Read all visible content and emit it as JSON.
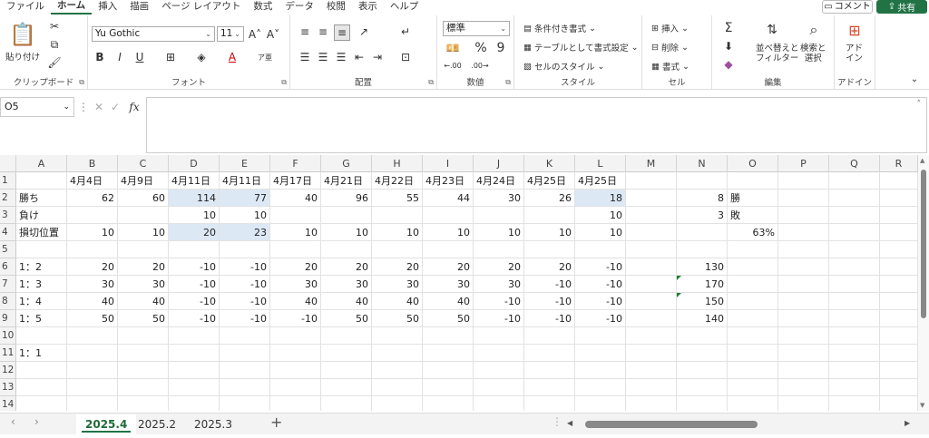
{
  "menu": [
    "ファイル",
    "ホーム",
    "挿入",
    "描画",
    "ページ レイアウト",
    "数式",
    "データ",
    "校閲",
    "表示",
    "ヘルプ"
  ],
  "menu_active": "ホーム",
  "comment_label": "コメント",
  "share_label": "共有",
  "ribbon": {
    "clipboard": {
      "paste": "貼り付け",
      "label": "クリップボード"
    },
    "font": {
      "name": "Yu Gothic",
      "size": "11",
      "label": "フォント",
      "bold": "B",
      "italic": "I",
      "underline": "U"
    },
    "align": {
      "label": "配置"
    },
    "number": {
      "format": "標準",
      "label": "数値",
      "percent": "%",
      "comma": "9"
    },
    "styles": {
      "cond": "条件付き書式",
      "table": "テーブルとして書式設定",
      "cell": "セルのスタイル",
      "label": "スタイル"
    },
    "cells": {
      "insert": "挿入",
      "delete": "削除",
      "format": "書式",
      "label": "セル"
    },
    "edit": {
      "sort": "並べ替えと\nフィルター",
      "sort1": "並べ替えと",
      "sort2": "フィルター",
      "find1": "検索と",
      "find2": "選択",
      "label": "編集"
    },
    "addin": {
      "name1": "アド",
      "name2": "イン",
      "label": "アドイン"
    }
  },
  "namebox": "O5",
  "fx": "fx",
  "columns": [
    "A",
    "B",
    "C",
    "D",
    "E",
    "F",
    "G",
    "H",
    "I",
    "J",
    "K",
    "L",
    "M",
    "N",
    "O",
    "P",
    "Q",
    "R"
  ],
  "rows": [
    [
      "",
      "4月4日",
      "4月9日",
      "4月11日",
      "4月11日",
      "4月17日",
      "4月21日",
      "4月22日",
      "4月23日",
      "4月24日",
      "4月25日",
      "4月25日",
      "",
      "",
      "",
      "",
      "",
      ""
    ],
    [
      "勝ち",
      "62",
      "60",
      "114",
      "77",
      "40",
      "96",
      "55",
      "44",
      "30",
      "26",
      "18",
      "",
      "8",
      "勝",
      "",
      "",
      ""
    ],
    [
      "負け",
      "",
      "",
      "10",
      "10",
      "",
      "",
      "",
      "",
      "",
      "",
      "10",
      "",
      "3",
      "敗",
      "",
      "",
      ""
    ],
    [
      "損切位置",
      "10",
      "10",
      "20",
      "23",
      "10",
      "10",
      "10",
      "10",
      "10",
      "10",
      "10",
      "",
      "",
      "63%",
      "",
      "",
      ""
    ],
    [
      "",
      "",
      "",
      "",
      "",
      "",
      "",
      "",
      "",
      "",
      "",
      "",
      "",
      "",
      "",
      "",
      "",
      ""
    ],
    [
      "1：2",
      "20",
      "20",
      "-10",
      "-10",
      "20",
      "20",
      "20",
      "20",
      "20",
      "20",
      "-10",
      "",
      "130",
      "",
      "",
      "",
      ""
    ],
    [
      "1：3",
      "30",
      "30",
      "-10",
      "-10",
      "30",
      "30",
      "30",
      "30",
      "30",
      "-10",
      "-10",
      "",
      "170",
      "",
      "",
      "",
      ""
    ],
    [
      "1：4",
      "40",
      "40",
      "-10",
      "-10",
      "40",
      "40",
      "40",
      "40",
      "-10",
      "-10",
      "-10",
      "",
      "150",
      "",
      "",
      "",
      ""
    ],
    [
      "1：5",
      "50",
      "50",
      "-10",
      "-10",
      "-10",
      "50",
      "50",
      "50",
      "-10",
      "-10",
      "-10",
      "",
      "140",
      "",
      "",
      "",
      ""
    ],
    [
      "",
      "",
      "",
      "",
      "",
      "",
      "",
      "",
      "",
      "",
      "",
      "",
      "",
      "",
      "",
      "",
      "",
      ""
    ],
    [
      "1：1",
      "",
      "",
      "",
      "",
      "",
      "",
      "",
      "",
      "",
      "",
      "",
      "",
      "",
      "",
      "",
      "",
      ""
    ],
    [
      "",
      "",
      "",
      "",
      "",
      "",
      "",
      "",
      "",
      "",
      "",
      "",
      "",
      "",
      "",
      "",
      "",
      ""
    ],
    [
      "",
      "",
      "",
      "",
      "",
      "",
      "",
      "",
      "",
      "",
      "",
      "",
      "",
      "",
      "",
      "",
      "",
      ""
    ],
    [
      "",
      "",
      "",
      "",
      "",
      "",
      "",
      "",
      "",
      "",
      "",
      "",
      "",
      "",
      "",
      "",
      "",
      ""
    ]
  ],
  "row_numbers": [
    "1",
    "2",
    "3",
    "4",
    "5",
    "6",
    "7",
    "8",
    "9",
    "10",
    "11",
    "12",
    "13",
    "14"
  ],
  "sheets": [
    "2025.4",
    "2025.2",
    "2025.3"
  ],
  "active_sheet": "2025.4",
  "add_sheet": "+",
  "colors": {
    "accent": "#217346",
    "highlight": "#dde8f5"
  }
}
